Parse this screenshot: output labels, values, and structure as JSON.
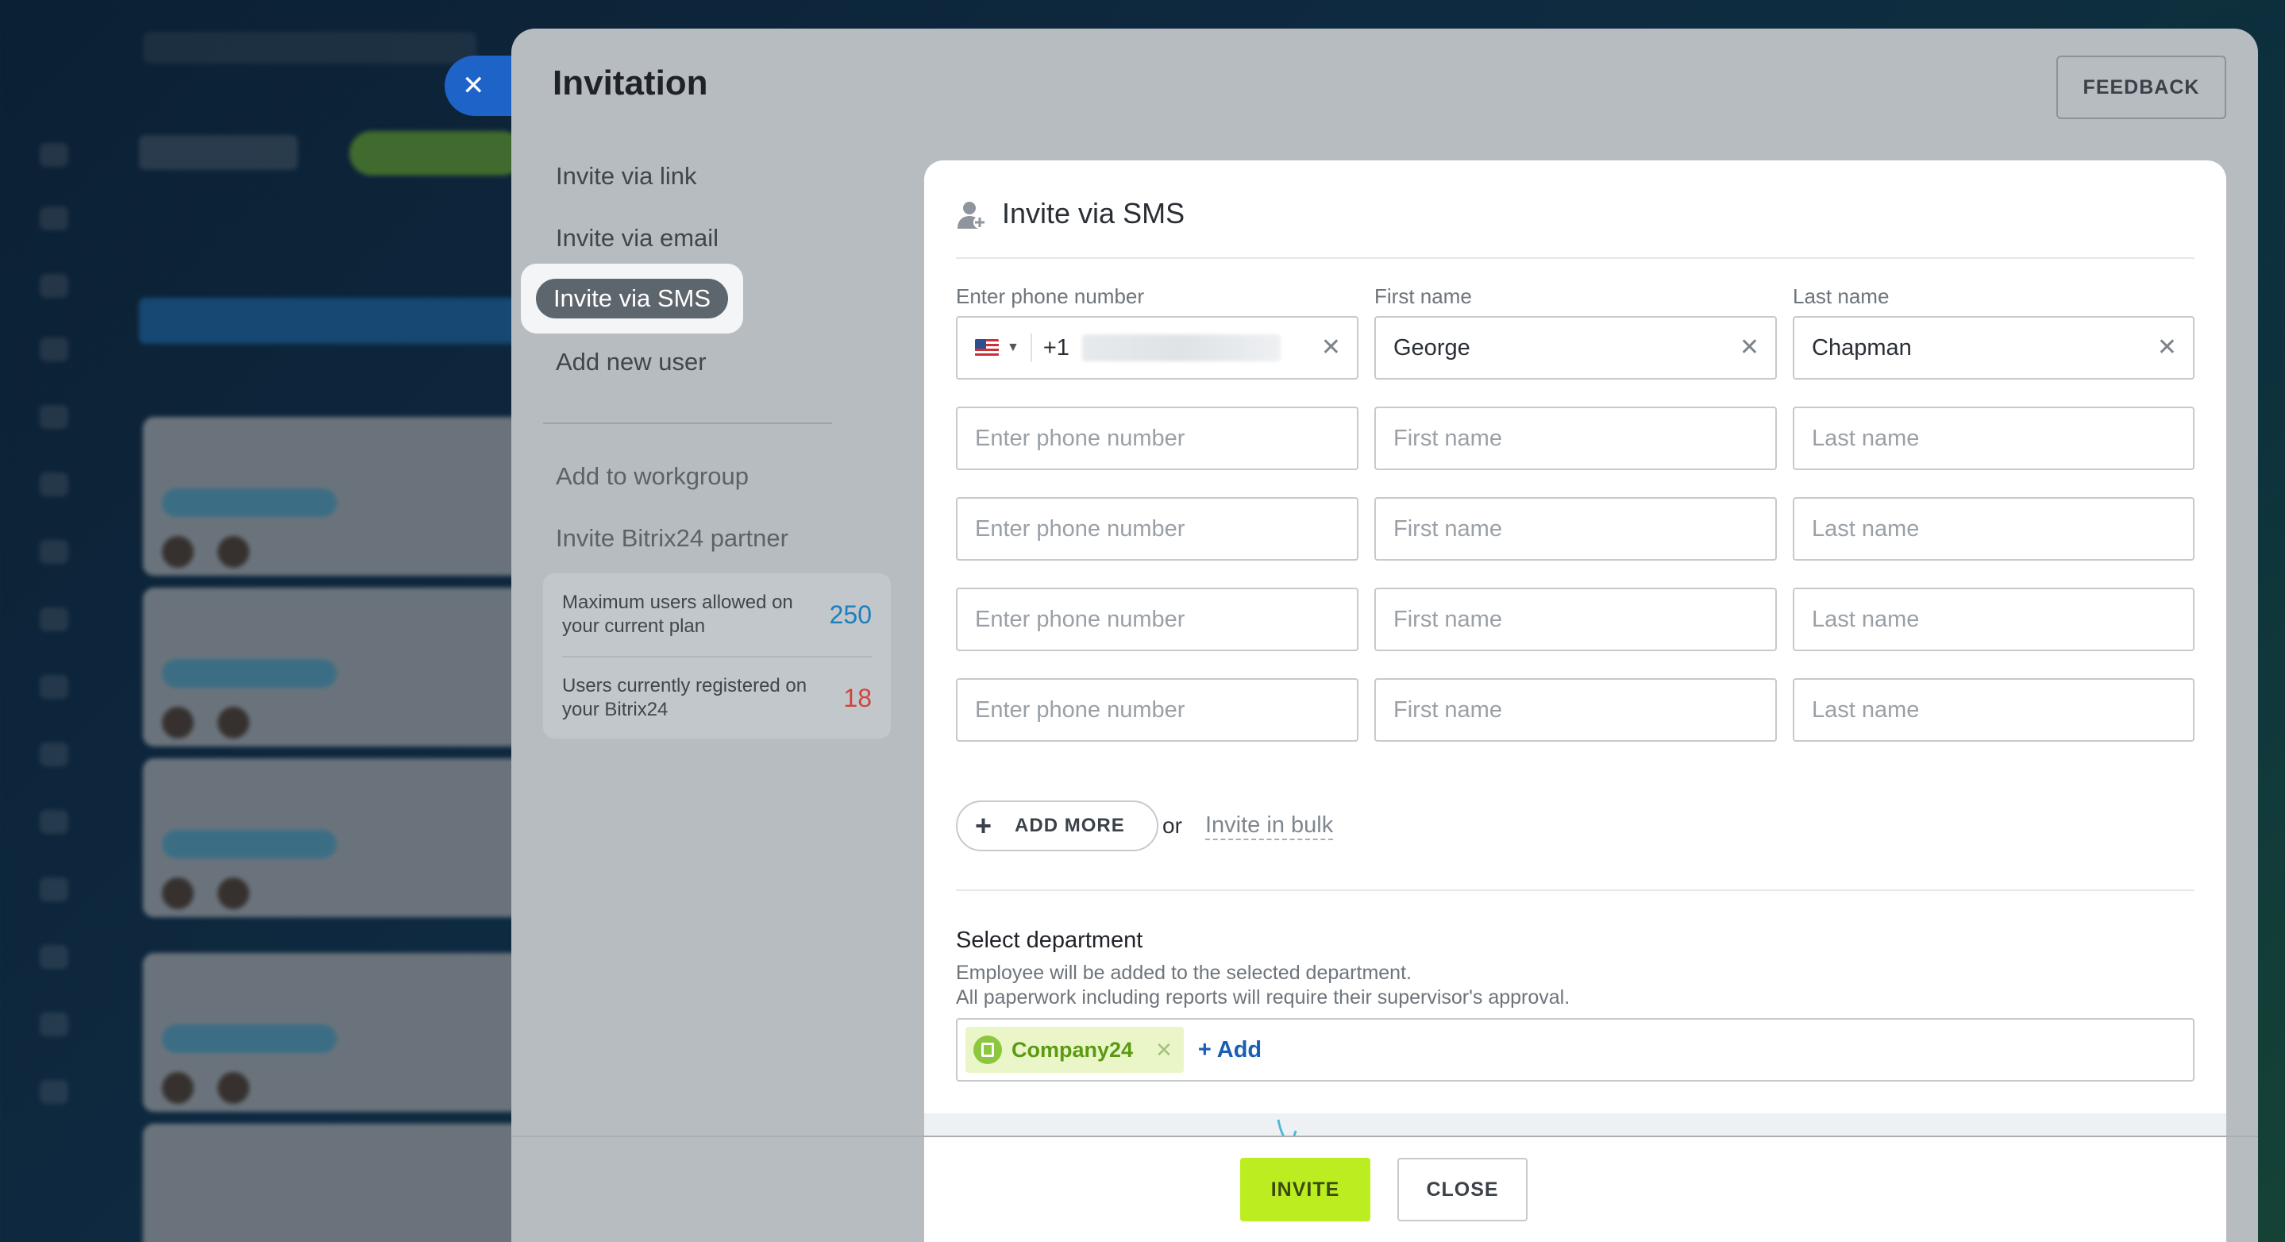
{
  "modal": {
    "title": "Invitation",
    "feedback_label": "FEEDBACK",
    "close_icon": "close-icon"
  },
  "menu": {
    "items": [
      {
        "label": "Invite via link"
      },
      {
        "label": "Invite via email"
      },
      {
        "label": "Invite via SMS",
        "active": true
      },
      {
        "label": "Add new user"
      },
      {
        "label": "Add to workgroup"
      },
      {
        "label": "Invite Bitrix24 partner"
      }
    ]
  },
  "stats": {
    "max_label": "Maximum users allowed on your current plan",
    "max_value": "250",
    "registered_label": "Users currently registered on your Bitrix24",
    "registered_value": "18"
  },
  "panel": {
    "title": "Invite via SMS",
    "icon": "person-icon",
    "col_phone": "Enter phone number",
    "col_first": "First name",
    "col_last": "Last name",
    "rows": [
      {
        "phone_prefix": "+1",
        "first": "George",
        "last": "Chapman",
        "country": "US"
      },
      {
        "phone_placeholder": "Enter phone number",
        "first_placeholder": "First name",
        "last_placeholder": "Last name"
      },
      {
        "phone_placeholder": "Enter phone number",
        "first_placeholder": "First name",
        "last_placeholder": "Last name"
      },
      {
        "phone_placeholder": "Enter phone number",
        "first_placeholder": "First name",
        "last_placeholder": "Last name"
      },
      {
        "phone_placeholder": "Enter phone number",
        "first_placeholder": "First name",
        "last_placeholder": "Last name"
      }
    ],
    "add_more_label": "ADD MORE",
    "or_text": "or",
    "bulk_label": "Invite in bulk",
    "department": {
      "title": "Select department",
      "desc_line1": "Employee will be added to the selected department.",
      "desc_line2": "All paperwork including reports will require their supervisor's approval.",
      "chip_label": "Company24",
      "add_label": "+ Add"
    }
  },
  "footer": {
    "invite_label": "INVITE",
    "close_label": "CLOSE"
  },
  "colors": {
    "accent_green": "#bbed21",
    "link_blue": "#1b5fb5",
    "stat_blue": "#1b7fbf",
    "stat_red": "#d0453b"
  }
}
